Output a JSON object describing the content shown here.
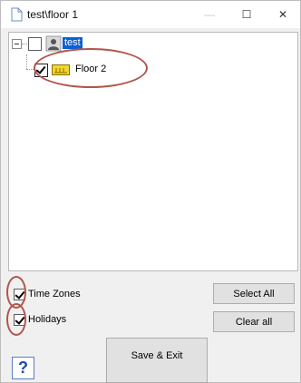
{
  "window": {
    "title": "test\\floor 1",
    "minimize_glyph": "—",
    "maximize_glyph": "☐",
    "close_glyph": "✕"
  },
  "tree": {
    "root": {
      "label": "test",
      "checked": false,
      "icon": "user-icon"
    },
    "children": [
      {
        "label": "Floor 2",
        "checked": true,
        "icon": "floor-icon"
      }
    ]
  },
  "options": {
    "time_zones": {
      "label": "Time Zones",
      "checked": true
    },
    "holidays": {
      "label": "Holidays",
      "checked": true
    }
  },
  "buttons": {
    "select_all": "Select All",
    "clear_all": "Clear all",
    "save_exit": "Save & Exit",
    "help": "?"
  },
  "colors": {
    "selection": "#0a5fd6",
    "highlight_annotation": "#b0564b",
    "help_text": "#1f47b3"
  }
}
